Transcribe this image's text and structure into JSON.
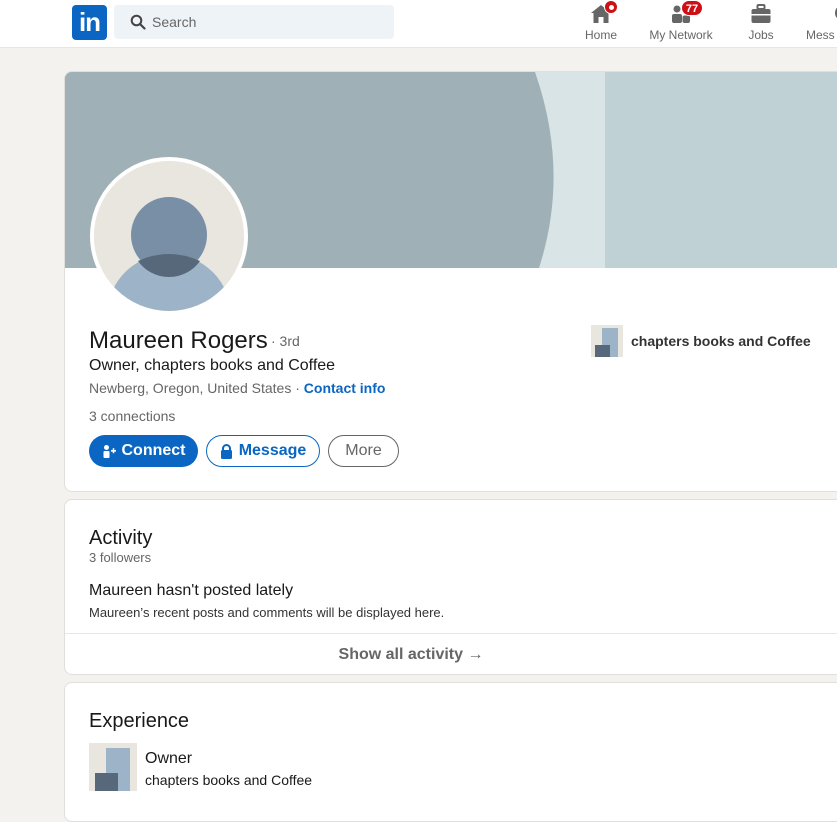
{
  "nav": {
    "logo_text": "in",
    "search_placeholder": "Search",
    "items": [
      {
        "label": "Home",
        "icon": "home-icon",
        "badge": ""
      },
      {
        "label": "My Network",
        "icon": "network-icon",
        "badge": "77"
      },
      {
        "label": "Jobs",
        "icon": "briefcase-icon",
        "badge": ""
      },
      {
        "label": "Mess",
        "icon": "messaging-icon",
        "badge": ""
      }
    ]
  },
  "profile": {
    "name": "Maureen Rogers",
    "degree": "· 3rd",
    "headline": "Owner, chapters books and Coffee",
    "location": "Newberg, Oregon, United States ·",
    "contact_info": "Contact info",
    "connections": "3 connections",
    "current_company": "chapters books and Coffee",
    "buttons": {
      "connect": "Connect",
      "message": "Message",
      "more": "More"
    }
  },
  "activity": {
    "title": "Activity",
    "followers": "3 followers",
    "empty_title": "Maureen hasn't posted lately",
    "empty_desc": "Maureen’s recent posts and comments will be displayed here.",
    "show_all": "Show all activity →"
  },
  "experience": {
    "title": "Experience",
    "items": [
      {
        "role": "Owner",
        "company": "chapters books and Coffee"
      }
    ]
  },
  "colors": {
    "brand": "#0a66c2",
    "badge": "#cc1016",
    "banner_light": "#c0d1d5",
    "banner_dark": "#9fb1b6"
  }
}
